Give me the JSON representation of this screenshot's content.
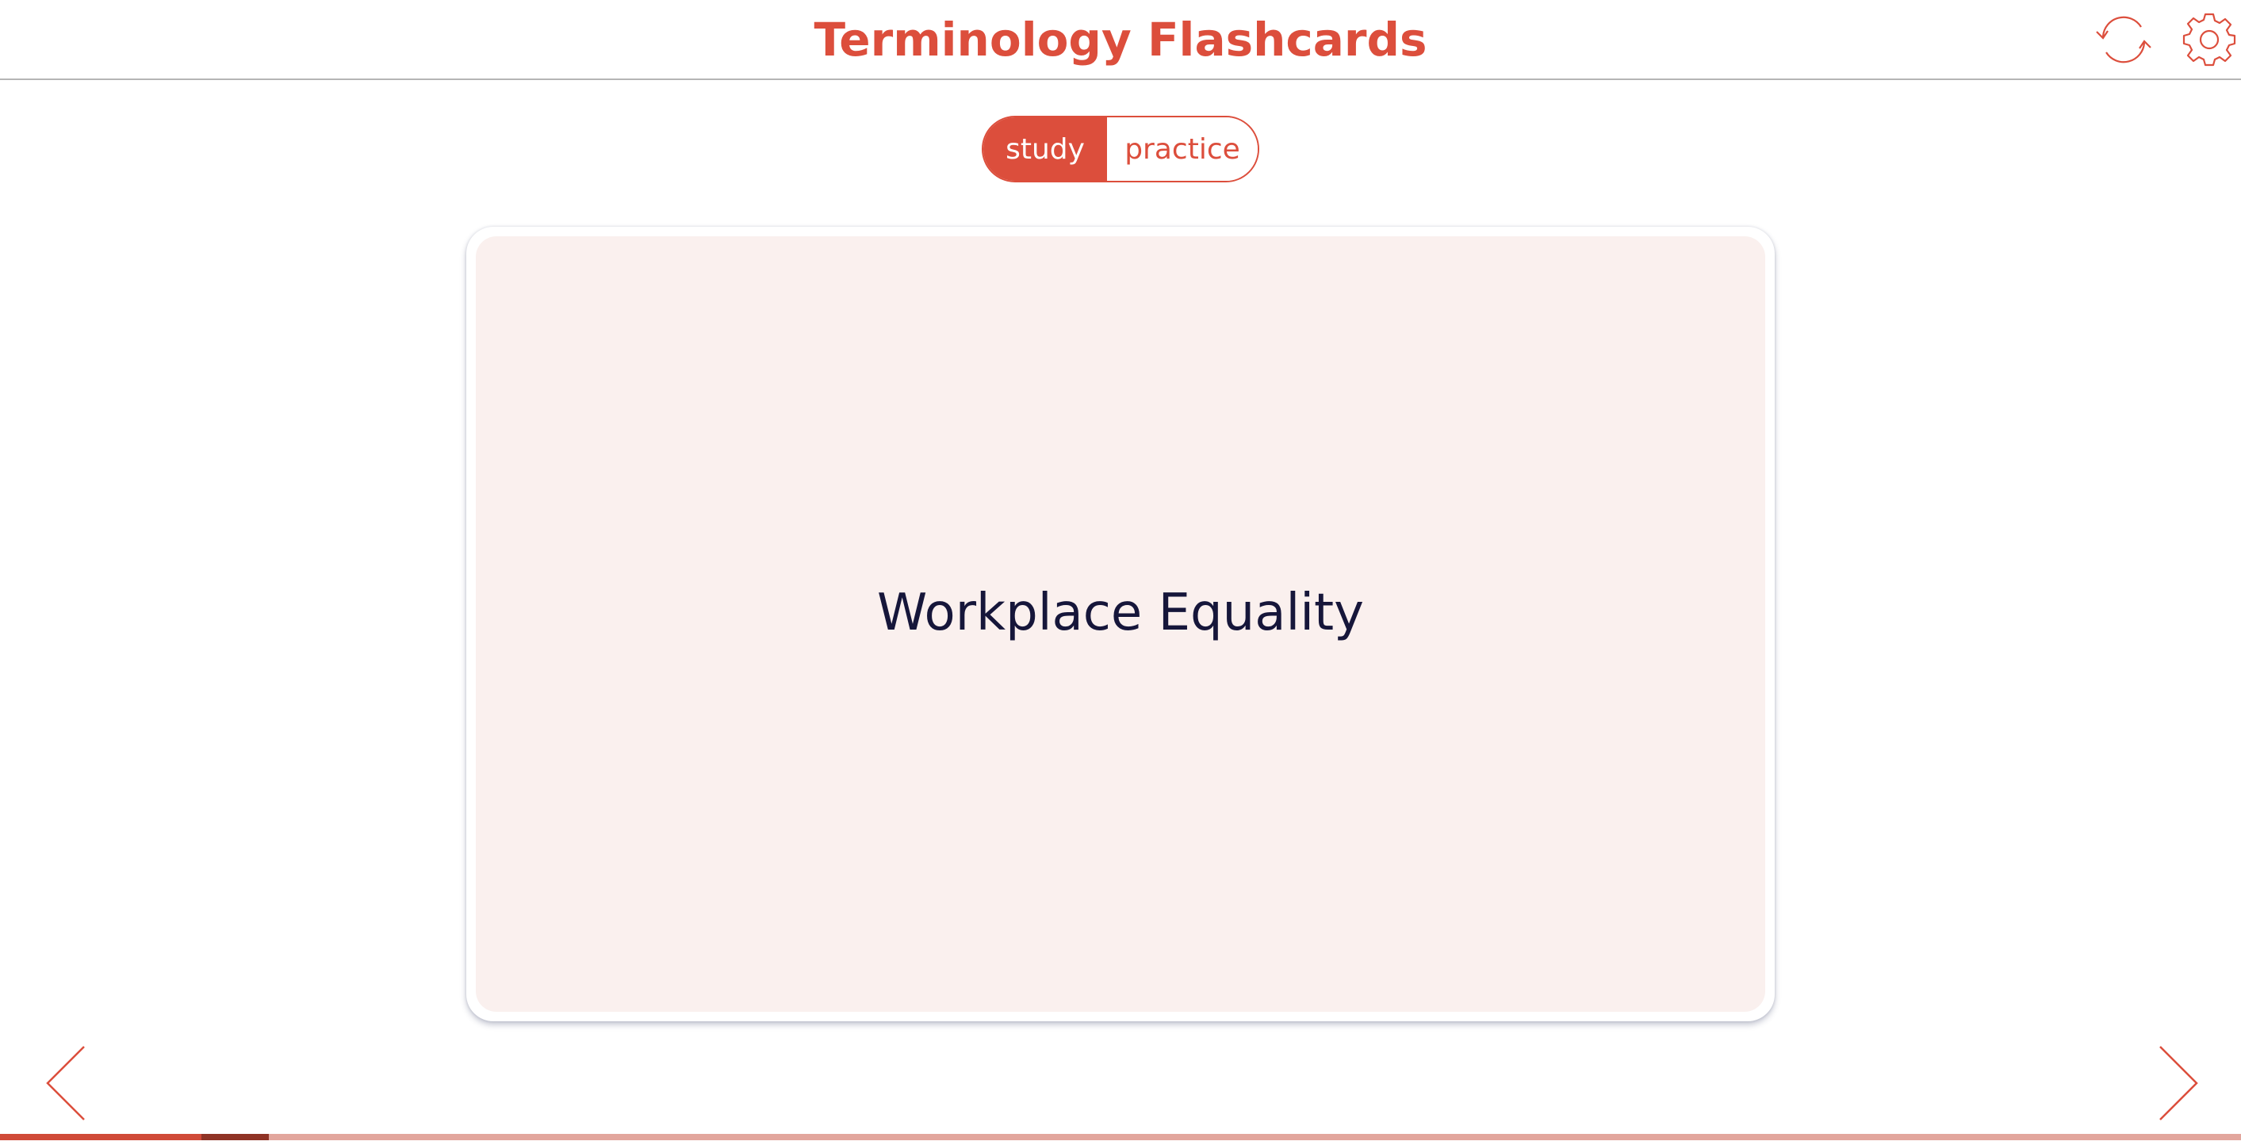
{
  "header": {
    "title": "Terminology Flashcards",
    "refresh_icon": "refresh-icon",
    "settings_icon": "gear-icon"
  },
  "mode_toggle": {
    "options": [
      "study",
      "practice"
    ],
    "selected": "study"
  },
  "card": {
    "term": "Workplace Equality"
  },
  "navigation": {
    "prev_icon": "chevron-left-icon",
    "next_icon": "chevron-right-icon"
  },
  "progress": {
    "completed_fraction": 0.09,
    "current_fraction": 0.03
  },
  "colors": {
    "accent": "#dc4e3c",
    "card_background": "#faf0ee",
    "card_text": "#16163a",
    "progress_track": "#e2a69d",
    "progress_current": "#8f3325"
  }
}
